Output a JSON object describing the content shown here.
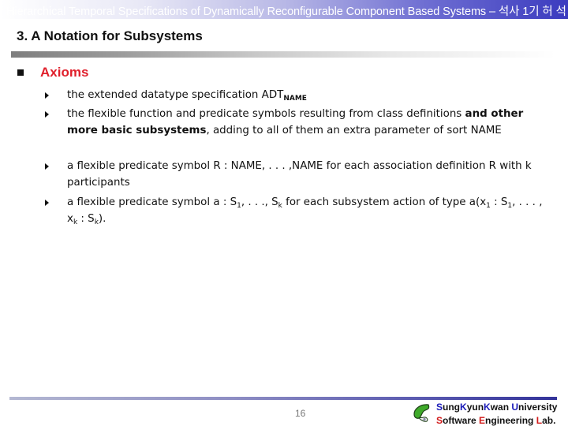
{
  "header": {
    "running_title": "Hierarchical Temporal Specifications of Dynamically Reconfigurable Component Based Systems – 석사 1기 허 석"
  },
  "slide": {
    "title": "3. A Notation for Subsystems",
    "section_label": "Axioms",
    "items": [
      {
        "parts": [
          {
            "t": "the extended datatype specification ADT"
          },
          {
            "t": "NAME",
            "style": "sub-bold"
          }
        ]
      },
      {
        "parts": [
          {
            "t": "the flexible function and predicate symbols resulting from class definitions "
          },
          {
            "t": "and other more basic subsystems",
            "style": "bold"
          },
          {
            "t": ", adding to all of them an extra parameter of sort NAME"
          }
        ]
      },
      {
        "parts": [
          {
            "t": "a flexible predicate symbol R : NAME, . . . ,NAME for each association definition R with k participants"
          }
        ]
      },
      {
        "parts": [
          {
            "t": "a flexible predicate symbol a : S"
          },
          {
            "t": "1",
            "style": "sub"
          },
          {
            "t": ", . . ., S"
          },
          {
            "t": "k",
            "style": "sub"
          },
          {
            "t": " for each subsystem action of type a(x"
          },
          {
            "t": "1",
            "style": "sub"
          },
          {
            "t": " : S"
          },
          {
            "t": "1",
            "style": "sub"
          },
          {
            "t": ", . . . , x"
          },
          {
            "t": "k",
            "style": "sub"
          },
          {
            "t": " : S"
          },
          {
            "t": "k",
            "style": "sub"
          },
          {
            "t": ")."
          }
        ]
      }
    ]
  },
  "footer": {
    "page_number": "16",
    "university": [
      {
        "t": "S",
        "accent": "blue"
      },
      {
        "t": "ung"
      },
      {
        "t": "K",
        "accent": "blue"
      },
      {
        "t": "yun"
      },
      {
        "t": "K",
        "accent": "blue"
      },
      {
        "t": "wan "
      },
      {
        "t": "U",
        "accent": "blue"
      },
      {
        "t": "niversity"
      }
    ],
    "lab": [
      {
        "t": "S",
        "accent": "red"
      },
      {
        "t": "oftware "
      },
      {
        "t": "E",
        "accent": "red"
      },
      {
        "t": "ngineering "
      },
      {
        "t": "L",
        "accent": "red"
      },
      {
        "t": "ab."
      }
    ],
    "logo_icon": "ginkgo-leaf-logo"
  },
  "colors": {
    "section_label": "#e0202c",
    "header_gradient_end": "#3b3bbf",
    "logo_green": "#3faa2a",
    "accent_blue": "#1a1ab8",
    "accent_red": "#d21a1a"
  }
}
